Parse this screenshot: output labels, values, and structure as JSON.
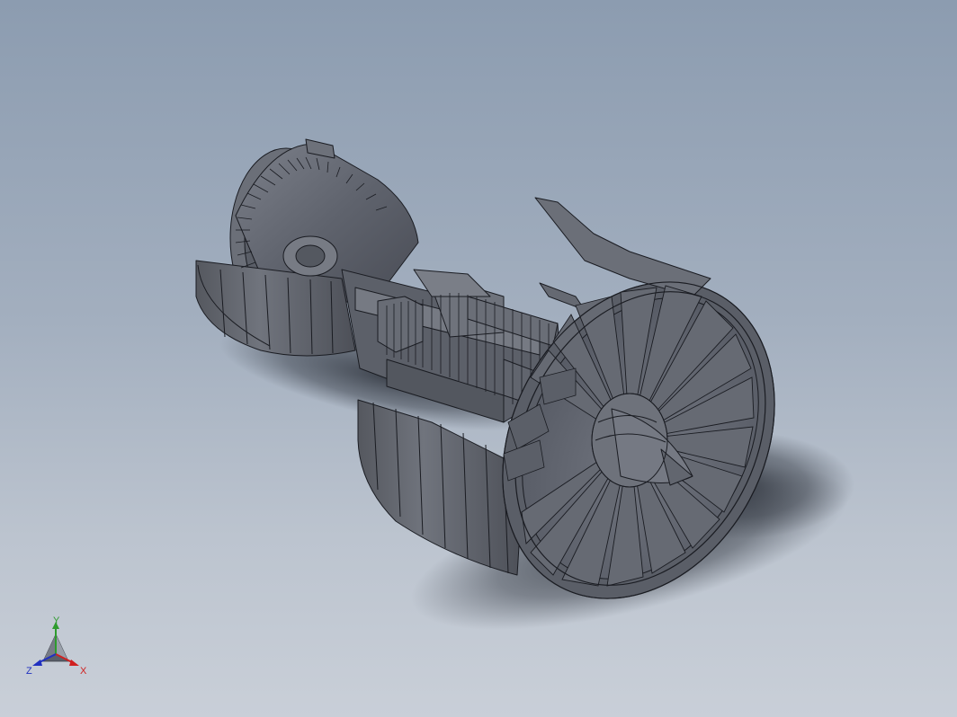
{
  "viewport": {
    "background_top": "#8c9cb0",
    "background_bottom": "#c9cfd8",
    "model_color": "#5f636d",
    "edge_color": "#1a1c22"
  },
  "triad": {
    "y_label": "Y",
    "x_label": "X",
    "z_label": "Z",
    "y_color": "#2e9b2e",
    "x_color": "#d02020",
    "z_color": "#2030c0"
  }
}
